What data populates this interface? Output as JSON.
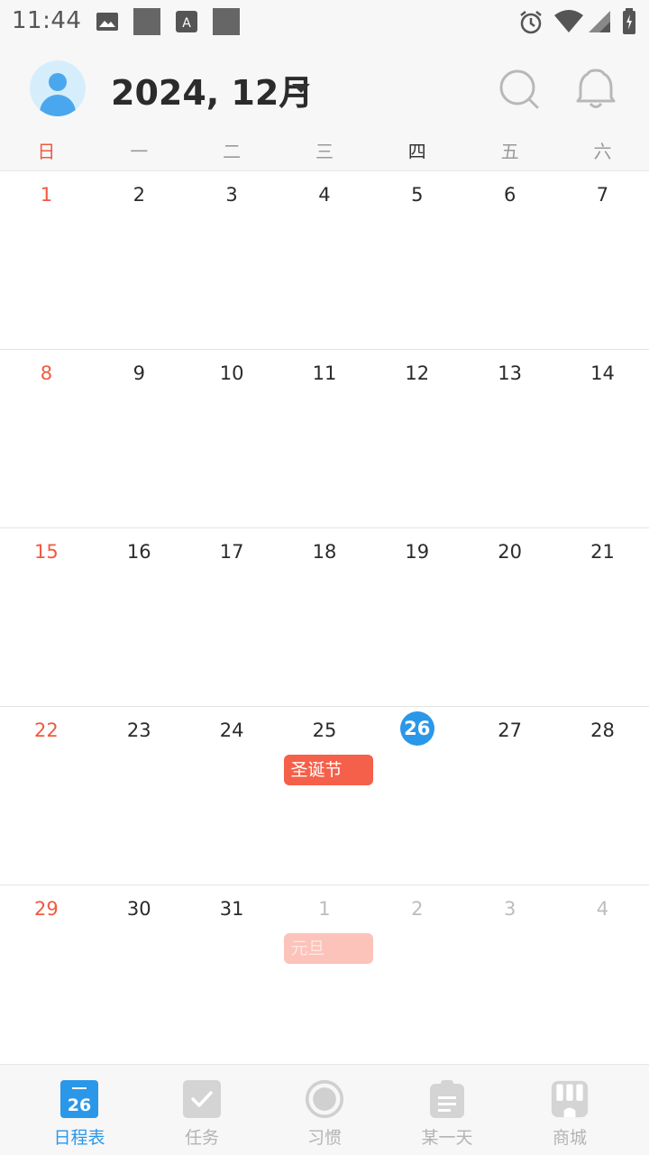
{
  "status_bar": {
    "time": "11:44"
  },
  "header": {
    "month_title": "2024, 12月"
  },
  "weekdays": [
    "日",
    "一",
    "二",
    "三",
    "四",
    "五",
    "六"
  ],
  "calendar": {
    "today": "26",
    "weeks": [
      [
        {
          "d": "1",
          "t": "sun"
        },
        {
          "d": "2"
        },
        {
          "d": "3"
        },
        {
          "d": "4"
        },
        {
          "d": "5"
        },
        {
          "d": "6"
        },
        {
          "d": "7"
        }
      ],
      [
        {
          "d": "8",
          "t": "sun"
        },
        {
          "d": "9"
        },
        {
          "d": "10"
        },
        {
          "d": "11"
        },
        {
          "d": "12"
        },
        {
          "d": "13"
        },
        {
          "d": "14"
        }
      ],
      [
        {
          "d": "15",
          "t": "sun"
        },
        {
          "d": "16"
        },
        {
          "d": "17"
        },
        {
          "d": "18"
        },
        {
          "d": "19"
        },
        {
          "d": "20"
        },
        {
          "d": "21"
        }
      ],
      [
        {
          "d": "22",
          "t": "sun"
        },
        {
          "d": "23"
        },
        {
          "d": "24"
        },
        {
          "d": "25",
          "event": "圣诞节"
        },
        {
          "d": "26",
          "t": "today"
        },
        {
          "d": "27"
        },
        {
          "d": "28"
        }
      ],
      [
        {
          "d": "29",
          "t": "sun"
        },
        {
          "d": "30"
        },
        {
          "d": "31"
        },
        {
          "d": "1",
          "t": "other",
          "event": "元旦"
        },
        {
          "d": "2",
          "t": "other"
        },
        {
          "d": "3",
          "t": "other"
        },
        {
          "d": "4",
          "t": "other"
        }
      ]
    ]
  },
  "bottom_nav": {
    "items": [
      {
        "label": "日程表",
        "icon": "calendar-icon",
        "badge": "26",
        "active": true
      },
      {
        "label": "任务",
        "icon": "checkbox-icon"
      },
      {
        "label": "习惯",
        "icon": "habit-circle-icon"
      },
      {
        "label": "某一天",
        "icon": "clipboard-icon"
      },
      {
        "label": "商城",
        "icon": "shop-icon"
      }
    ]
  },
  "colors": {
    "accent": "#2a97e8",
    "sunday": "#f05a40",
    "event": "#f46049",
    "event_faded": "#fcc3bb"
  }
}
